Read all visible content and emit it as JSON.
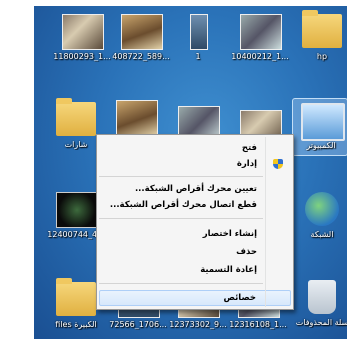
{
  "desktop_icons": [
    {
      "label": "11800293_1...",
      "kind": "photo"
    },
    {
      "label": "408722_589...",
      "kind": "photo2"
    },
    {
      "label": "1",
      "kind": "photo3"
    },
    {
      "label": "10400212_1...",
      "kind": "photo4"
    },
    {
      "label": "hp",
      "kind": "folder"
    },
    {
      "label": "شارات",
      "kind": "folder"
    },
    {
      "label": "",
      "kind": "photo2"
    },
    {
      "label": "",
      "kind": "photo4"
    },
    {
      "label": "",
      "kind": "photo"
    },
    {
      "label": "الكمبيوتر",
      "kind": "pc"
    },
    {
      "label": "12400744_4...",
      "kind": "dark"
    },
    {
      "label": "الشبكة",
      "kind": "net"
    },
    {
      "label": "files الكبيرة",
      "kind": "folder"
    },
    {
      "label": "72566_1706...",
      "kind": "photo3"
    },
    {
      "label": "12373302_9...",
      "kind": "photo"
    },
    {
      "label": "12316108_1...",
      "kind": "photo4"
    },
    {
      "label": "سلة المحذوفات",
      "kind": "bin"
    }
  ],
  "context_menu": {
    "open": "فتح",
    "manage": "إدارة",
    "map_drive": "تعيين محرك أقراص الشبكة...",
    "disconnect_drive": "قطع اتصال محرك أقراص الشبكة...",
    "create_shortcut": "إنشاء اختصار",
    "delete": "حذف",
    "rename": "إعادة التسمية",
    "properties": "خصائص"
  }
}
